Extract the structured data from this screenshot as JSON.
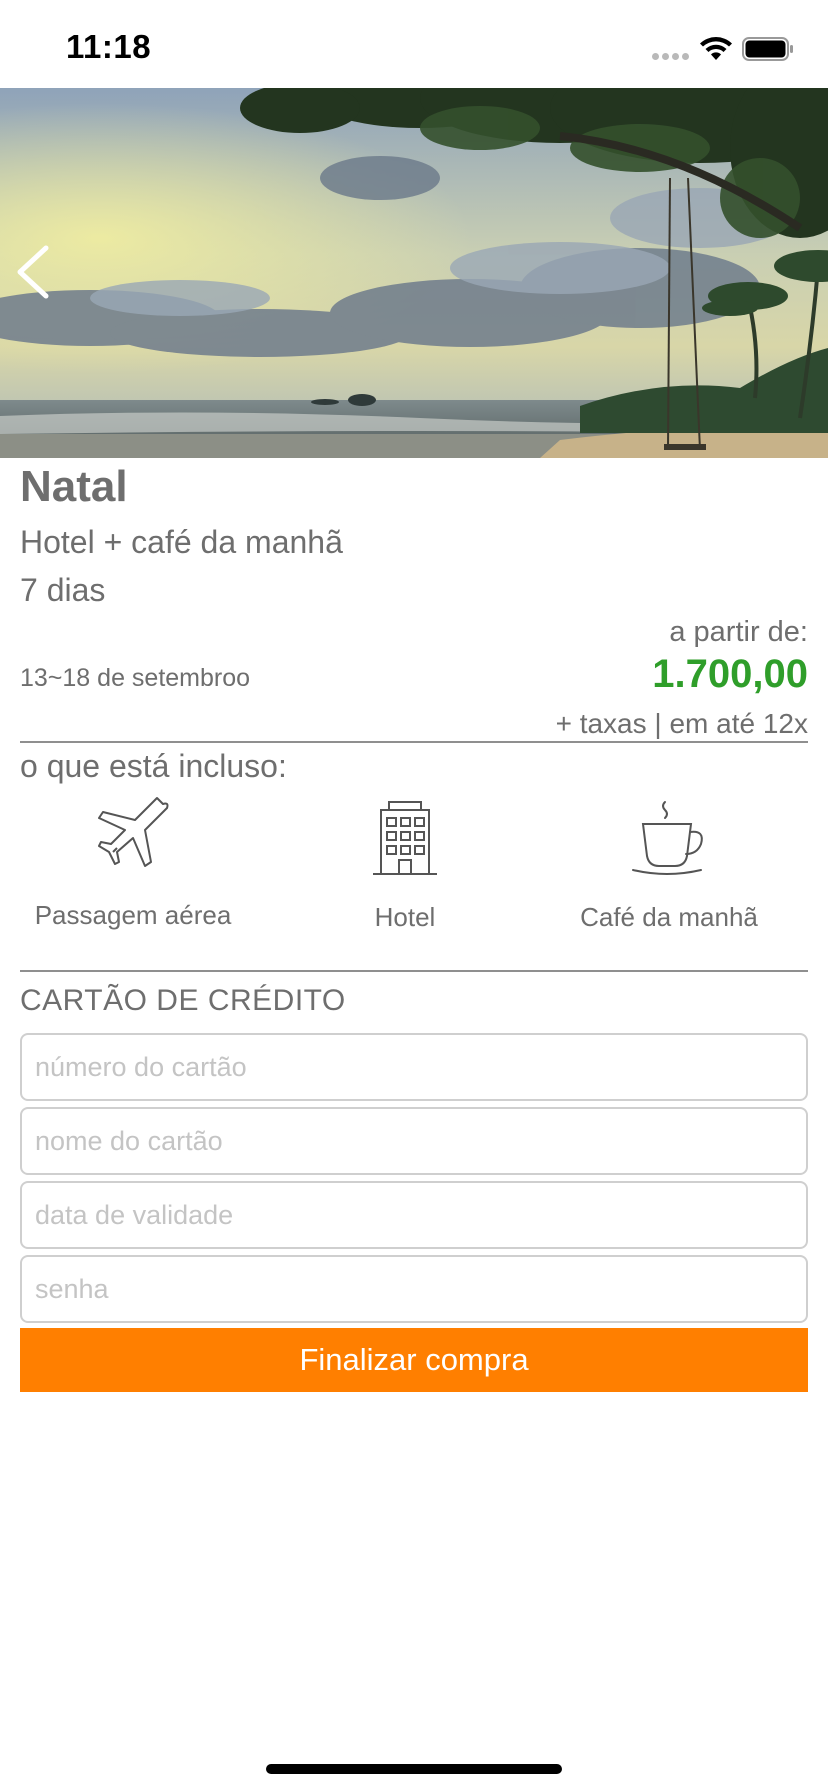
{
  "status_bar": {
    "time": "11:18"
  },
  "destination": {
    "name": "Natal",
    "package": "Hotel + café da manhã",
    "duration": "7 dias",
    "dates": "13~18 de setembroo",
    "price_prefix": "a partir de:",
    "price": "1.700,00",
    "price_note": "+ taxas | em até 12x"
  },
  "included": {
    "label": "o que está incluso:",
    "items": [
      {
        "label": "Passagem aérea",
        "icon": "airplane-icon"
      },
      {
        "label": "Hotel",
        "icon": "building-icon"
      },
      {
        "label": "Café da manhã",
        "icon": "coffee-cup-icon"
      }
    ]
  },
  "credit_card": {
    "header": "CARTÃO DE CRÉDITO",
    "fields": [
      {
        "placeholder": "número do cartão",
        "value": ""
      },
      {
        "placeholder": "nome do cartão",
        "value": ""
      },
      {
        "placeholder": "data de validade",
        "value": ""
      },
      {
        "placeholder": "senha",
        "value": ""
      }
    ],
    "submit_label": "Finalizar compra"
  },
  "colors": {
    "accent": "#ff7f00",
    "price": "#2f9e2a",
    "text": "#6e6e6e"
  }
}
